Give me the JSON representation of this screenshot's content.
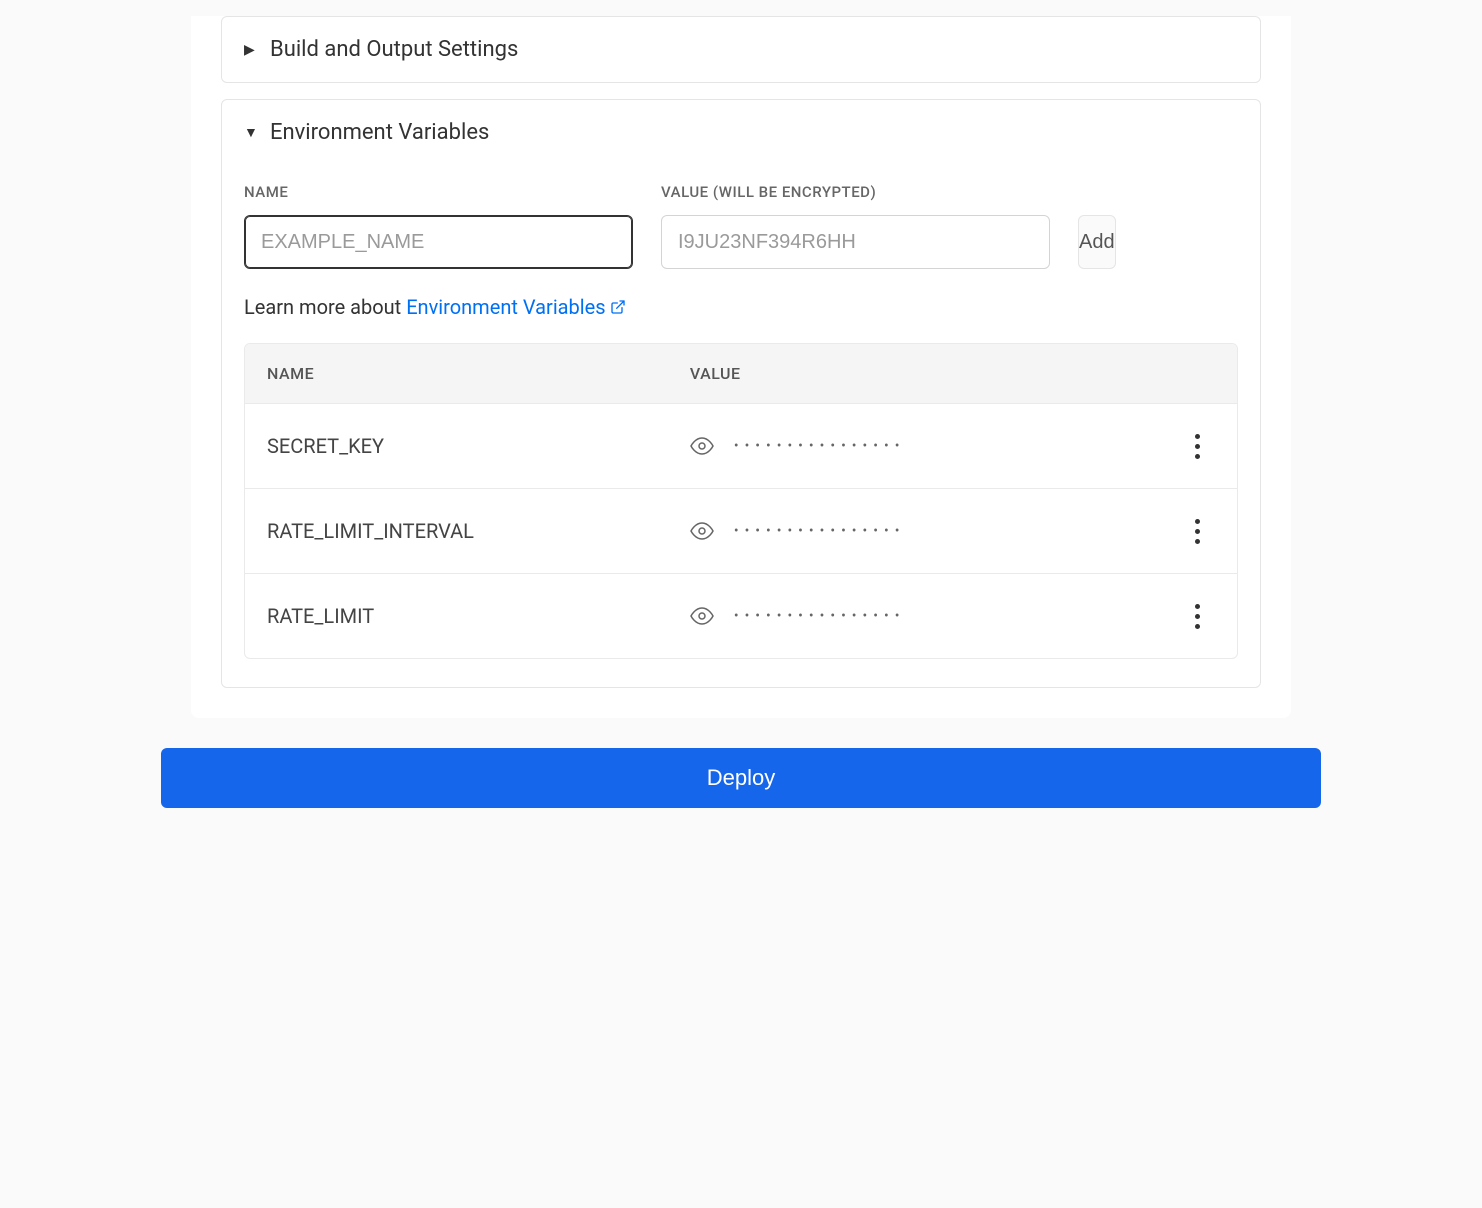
{
  "panels": {
    "build": {
      "title": "Build and Output Settings"
    },
    "env": {
      "title": "Environment Variables",
      "name_label": "Name",
      "value_label": "Value (will be encrypted)",
      "name_placeholder": "EXAMPLE_NAME",
      "value_placeholder": "I9JU23NF394R6HH",
      "add_label": "Add",
      "learn_more_prefix": "Learn more about ",
      "learn_more_link": "Environment Variables",
      "table": {
        "name_header": "NAME",
        "value_header": "VALUE",
        "rows": [
          {
            "name": "SECRET_KEY",
            "masked_value": "••••••••••••••••"
          },
          {
            "name": "RATE_LIMIT_INTERVAL",
            "masked_value": "••••••••••••••••"
          },
          {
            "name": "RATE_LIMIT",
            "masked_value": "••••••••••••••••"
          }
        ]
      }
    }
  },
  "deploy_label": "Deploy"
}
